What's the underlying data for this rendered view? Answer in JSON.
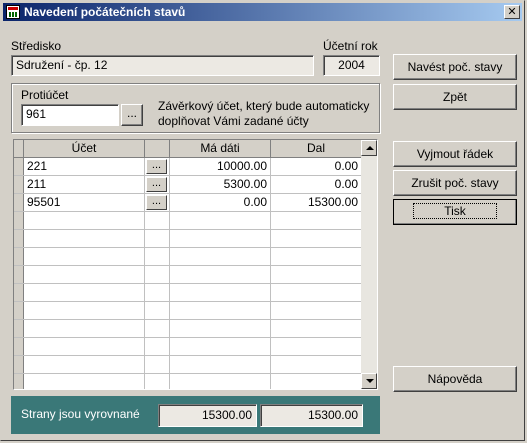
{
  "window": {
    "title": "Navedení počátečních stavů",
    "close_glyph": "✕"
  },
  "stredisko": {
    "label": "Středisko",
    "value": "Sdružení - čp. 12"
  },
  "ucetni_rok": {
    "label": "Účetní rok",
    "value": "2004"
  },
  "protiucet": {
    "label": "Protiúčet",
    "value": "961",
    "button": "...",
    "note_line1": "Závěrkový účet, který bude automaticky",
    "note_line2": "doplňovat Vámi zadané účty"
  },
  "grid": {
    "headers": [
      "Účet",
      "Má dáti",
      "Dal"
    ],
    "rows": [
      {
        "ucet": "221",
        "ma_dati": "10000.00",
        "dal": "0.00"
      },
      {
        "ucet": "211",
        "ma_dati": "5300.00",
        "dal": "0.00"
      },
      {
        "ucet": "95501",
        "ma_dati": "0.00",
        "dal": "15300.00"
      }
    ],
    "row_button": "..."
  },
  "buttons": {
    "navest": "Navést poč. stavy",
    "zpet": "Zpět",
    "vyjmout": "Vyjmout řádek",
    "zrusit": "Zrušit poč. stavy",
    "tisk": "Tisk",
    "napoveda": "Nápověda"
  },
  "footer": {
    "label": "Strany jsou vyrovnané",
    "ma_dati_total": "15300.00",
    "dal_total": "15300.00"
  },
  "colors": {
    "title_start": "#0a246a",
    "title_end": "#a6caf0",
    "footer_bg": "#3a7878"
  }
}
